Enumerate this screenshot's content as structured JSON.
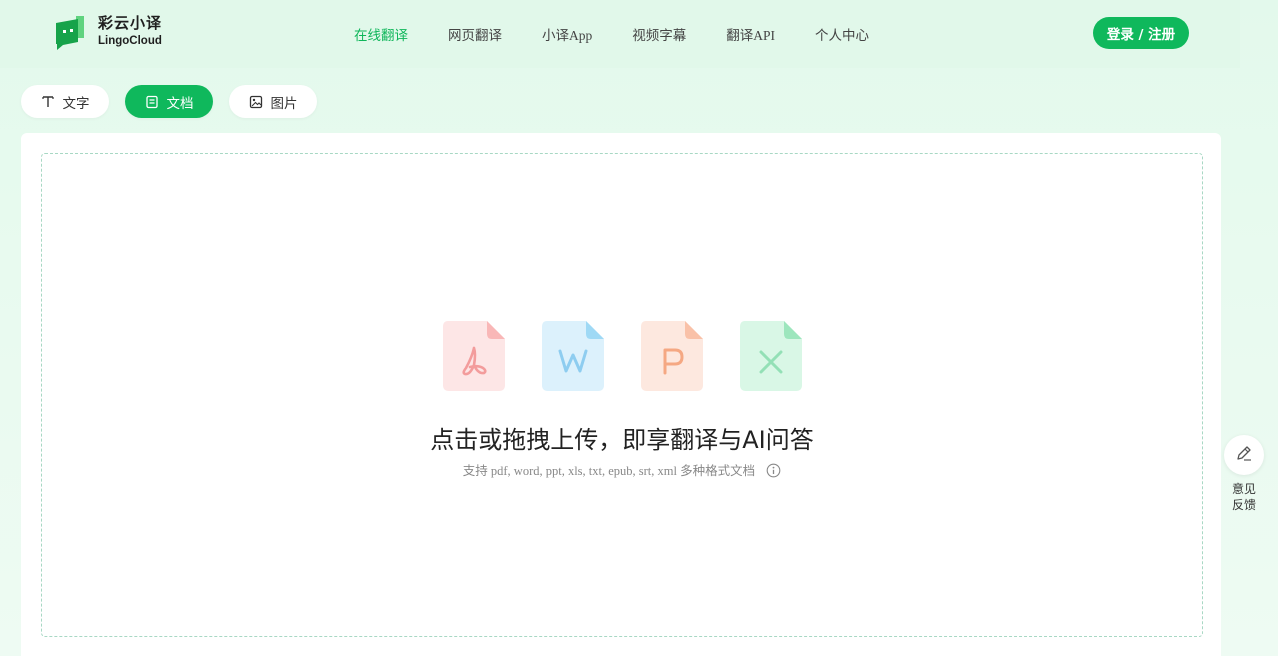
{
  "header": {
    "logo_cn": "彩云小译",
    "logo_en": "LingoCloud",
    "nav": [
      {
        "label": "在线翻译",
        "active": true
      },
      {
        "label": "网页翻译",
        "active": false
      },
      {
        "label": "小译App",
        "active": false
      },
      {
        "label": "视频字幕",
        "active": false
      },
      {
        "label": "翻译API",
        "active": false
      },
      {
        "label": "个人中心",
        "active": false
      }
    ],
    "login_label": "登录 / 注册"
  },
  "tabs": [
    {
      "label": "文字",
      "icon": "text-icon",
      "active": false
    },
    {
      "label": "文档",
      "icon": "document-icon",
      "active": true
    },
    {
      "label": "图片",
      "icon": "image-icon",
      "active": false
    }
  ],
  "upload": {
    "file_types": [
      "pdf-file-icon",
      "word-file-icon",
      "ppt-file-icon",
      "excel-file-icon"
    ],
    "title": "点击或拖拽上传，即享翻译与AI问答",
    "subtitle": "支持 pdf, word, ppt, xls, txt, epub, srt, xml 多种格式文档"
  },
  "feedback": {
    "label": "意见反馈"
  },
  "colors": {
    "accent": "#0fb85c",
    "pdf": "#fde6e6",
    "word": "#dcf1fc",
    "ppt": "#fde8df",
    "excel": "#d9f7e6"
  }
}
